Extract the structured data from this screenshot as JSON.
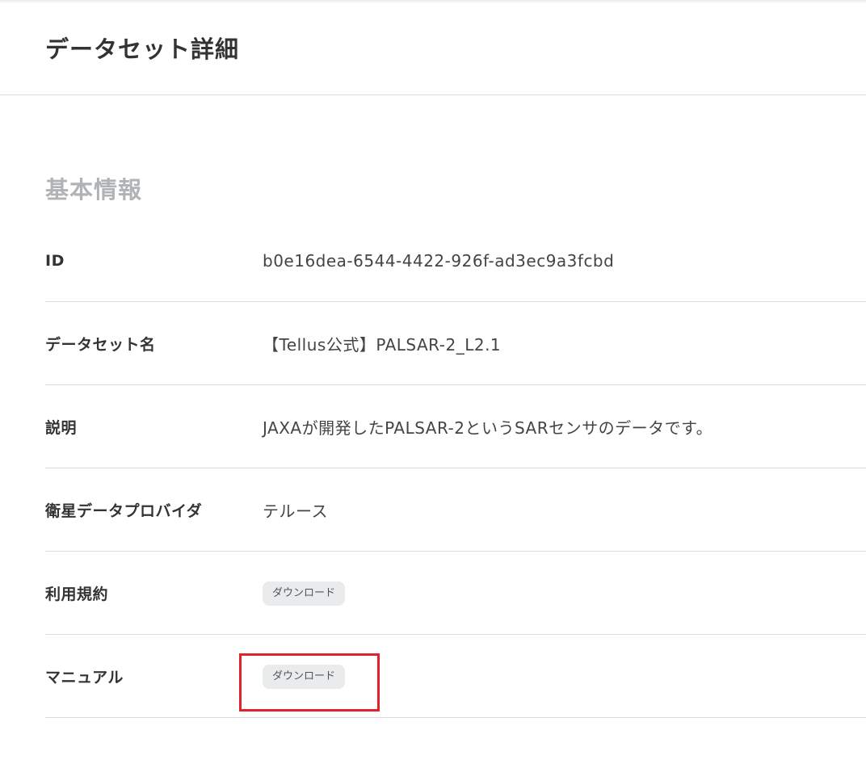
{
  "header": {
    "title": "データセット詳細"
  },
  "section": {
    "title": "基本情報"
  },
  "fields": {
    "id": {
      "label": "ID",
      "value": "b0e16dea-6544-4422-926f-ad3ec9a3fcbd"
    },
    "name": {
      "label": "データセット名",
      "value": "【Tellus公式】PALSAR-2_L2.1"
    },
    "description": {
      "label": "説明",
      "value": "JAXAが開発したPALSAR-2というSARセンサのデータです。"
    },
    "provider": {
      "label": "衛星データプロバイダ",
      "value": "テルース"
    },
    "terms": {
      "label": "利用規約",
      "button_label": "ダウンロード"
    },
    "manual": {
      "label": "マニュアル",
      "button_label": "ダウンロード"
    }
  },
  "colors": {
    "highlight": "#e3212c",
    "section_title": "#b0b3b6",
    "button_bg": "#e9ebec"
  }
}
